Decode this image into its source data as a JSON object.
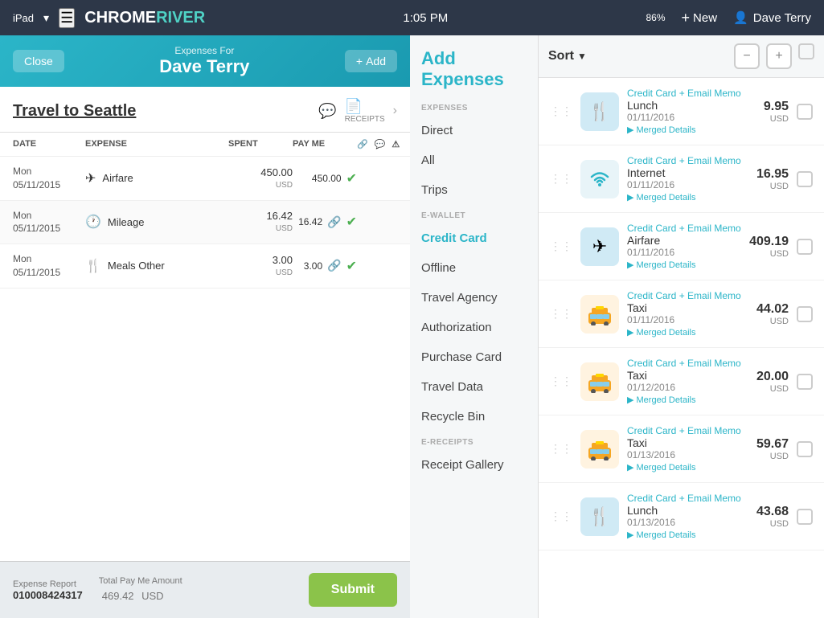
{
  "statusBar": {
    "time": "1:05 PM",
    "wifi": "WiFi",
    "device": "iPad",
    "battery": "86%",
    "newLabel": "New",
    "userName": "Dave Terry"
  },
  "header": {
    "closeLabel": "Close",
    "expensesForLabel": "Expenses For",
    "personName": "Dave Terry",
    "addLabel": "+ Add"
  },
  "report": {
    "title": "Travel to Seattle",
    "receiptsLabel": "RECEIPTS"
  },
  "tableHeaders": {
    "date": "DATE",
    "expense": "EXPENSE",
    "spent": "SPENT",
    "payMe": "PAY ME"
  },
  "expenses": [
    {
      "date": "Mon\n05/11/2015",
      "type": "Airfare",
      "spent": "450.00",
      "spentCurrency": "USD",
      "payMe": "450.00",
      "hasCheck": true,
      "hasLink": false
    },
    {
      "date": "Mon\n05/11/2015",
      "type": "Mileage",
      "spent": "16.42",
      "spentCurrency": "USD",
      "payMe": "16.42",
      "hasCheck": true,
      "hasLink": true
    },
    {
      "date": "Mon\n05/11/2015",
      "type": "Meals Other",
      "spent": "3.00",
      "spentCurrency": "USD",
      "payMe": "3.00",
      "hasCheck": true,
      "hasLink": true
    }
  ],
  "footer": {
    "expenseReportLabel": "Expense Report",
    "reportNumber": "010008424317",
    "totalPayMeLabel": "Total Pay Me Amount",
    "totalAmount": "469.42",
    "totalCurrency": "USD",
    "submitLabel": "Submit"
  },
  "addExpenses": {
    "title": "Add\nExpenses",
    "sections": {
      "expenses": "EXPENSES",
      "eWallet": "E-WALLET",
      "eReceipts": "E-RECEIPTS"
    },
    "items": {
      "expenseItems": [
        {
          "label": "Direct",
          "active": false
        },
        {
          "label": "All",
          "active": false
        },
        {
          "label": "Trips",
          "active": false
        }
      ],
      "eWalletItems": [
        {
          "label": "Credit Card",
          "active": true
        },
        {
          "label": "Offline",
          "active": false
        },
        {
          "label": "Travel Agency",
          "active": false
        },
        {
          "label": "Authorization",
          "active": false
        },
        {
          "label": "Purchase Card",
          "active": false
        },
        {
          "label": "Travel Data",
          "active": false
        },
        {
          "label": "Recycle Bin",
          "active": false
        }
      ],
      "eReceiptItems": [
        {
          "label": "Receipt Gallery",
          "active": false
        }
      ]
    }
  },
  "sortLabel": "Sort",
  "expensesList": [
    {
      "source": "Credit Card + Email Memo",
      "type": "Lunch",
      "date": "01/11/2016",
      "amount": "9.95",
      "currency": "USD",
      "icon": "🍴",
      "iconBg": "blue",
      "mergedLabel": "▶ Merged Details"
    },
    {
      "source": "Credit Card + Email Memo",
      "type": "Internet",
      "date": "01/11/2016",
      "amount": "16.95",
      "currency": "USD",
      "icon": "wifi",
      "iconBg": "blue",
      "mergedLabel": "▶ Merged Details"
    },
    {
      "source": "Credit Card + Email Memo",
      "type": "Airfare",
      "date": "01/11/2016",
      "amount": "409.19",
      "currency": "USD",
      "icon": "✈",
      "iconBg": "blue",
      "mergedLabel": "▶ Merged Details"
    },
    {
      "source": "Credit Card + Email Memo",
      "type": "Taxi",
      "date": "01/11/2016",
      "amount": "44.02",
      "currency": "USD",
      "icon": "taxi",
      "iconBg": "yellow",
      "mergedLabel": "▶ Merged Details"
    },
    {
      "source": "Credit Card + Email Memo",
      "type": "Taxi",
      "date": "01/12/2016",
      "amount": "20.00",
      "currency": "USD",
      "icon": "taxi",
      "iconBg": "yellow",
      "mergedLabel": "▶ Merged Details"
    },
    {
      "source": "Credit Card + Email Memo",
      "type": "Taxi",
      "date": "01/13/2016",
      "amount": "59.67",
      "currency": "USD",
      "icon": "taxi",
      "iconBg": "yellow",
      "mergedLabel": "▶ Merged Details"
    },
    {
      "source": "Credit Card + Email Memo",
      "type": "Lunch",
      "date": "01/13/2016",
      "amount": "43.68",
      "currency": "USD",
      "icon": "🍴",
      "iconBg": "blue",
      "mergedLabel": "▶ Merged Details"
    }
  ]
}
